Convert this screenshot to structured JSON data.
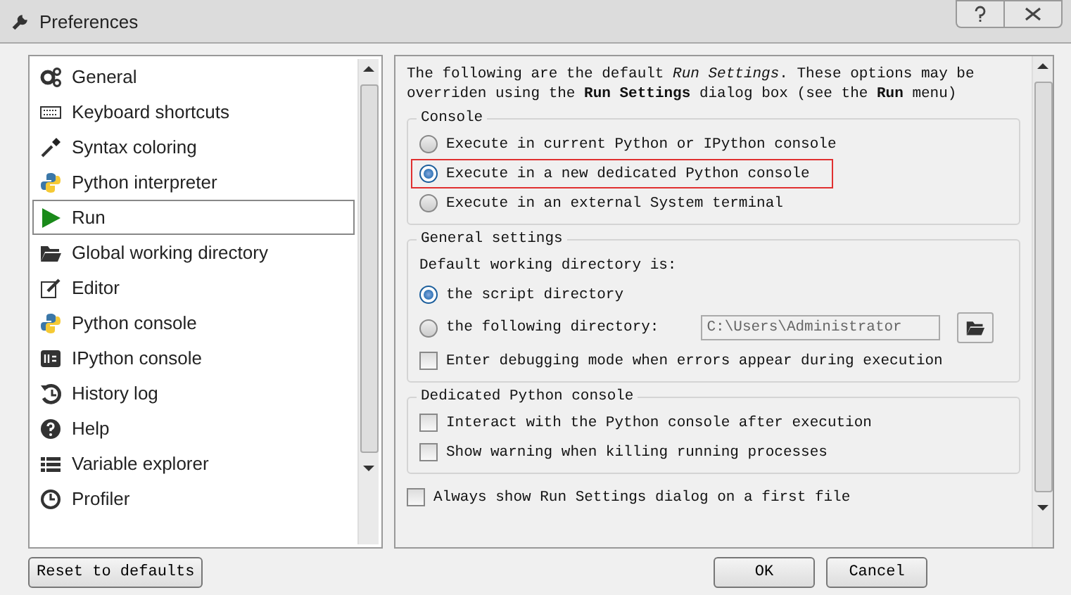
{
  "window": {
    "title": "Preferences"
  },
  "sidebar": {
    "items": [
      {
        "label": "General",
        "selected": false
      },
      {
        "label": "Keyboard shortcuts",
        "selected": false
      },
      {
        "label": "Syntax coloring",
        "selected": false
      },
      {
        "label": "Python interpreter",
        "selected": false
      },
      {
        "label": "Run",
        "selected": true
      },
      {
        "label": "Global working directory",
        "selected": false
      },
      {
        "label": "Editor",
        "selected": false
      },
      {
        "label": "Python console",
        "selected": false
      },
      {
        "label": "IPython console",
        "selected": false
      },
      {
        "label": "History log",
        "selected": false
      },
      {
        "label": "Help",
        "selected": false
      },
      {
        "label": "Variable explorer",
        "selected": false
      },
      {
        "label": "Profiler",
        "selected": false
      }
    ]
  },
  "page": {
    "intro": "The following are the default *Run Settings*. These options may be overriden using the **Run Settings** dialog box (see the **Run** menu)",
    "groups": [
      {
        "title": "Console",
        "items": [
          {
            "kind": "radio",
            "label": "Execute in current Python or IPython console",
            "selected": false,
            "highlighted": false
          },
          {
            "kind": "radio",
            "label": "Execute in a new dedicated Python console",
            "selected": true,
            "highlighted": true
          },
          {
            "kind": "radio",
            "label": "Execute in an external System terminal",
            "selected": false,
            "highlighted": false
          }
        ]
      },
      {
        "title": "General settings",
        "items": [
          {
            "kind": "label",
            "label": "Default working directory is:"
          },
          {
            "kind": "radio",
            "label": "the script directory",
            "selected": true,
            "highlighted": false
          },
          {
            "kind": "directory",
            "label": "the following directory:",
            "selected": false,
            "value": "C:\\Users\\Administrator",
            "disabled": true
          },
          {
            "kind": "checkbox",
            "label": "Enter debugging mode when errors appear during execution",
            "checked": false
          }
        ]
      },
      {
        "title": "Dedicated Python console",
        "items": [
          {
            "kind": "checkbox",
            "label": "Interact with the Python console after execution",
            "checked": false
          },
          {
            "kind": "checkbox",
            "label": "Show warning when killing running processes",
            "checked": false
          }
        ]
      }
    ],
    "footer_checkbox": {
      "label": "Always show Run Settings dialog on a first file",
      "checked": false
    }
  },
  "buttons": {
    "reset": "Reset to defaults",
    "ok": "OK",
    "cancel": "Cancel"
  }
}
